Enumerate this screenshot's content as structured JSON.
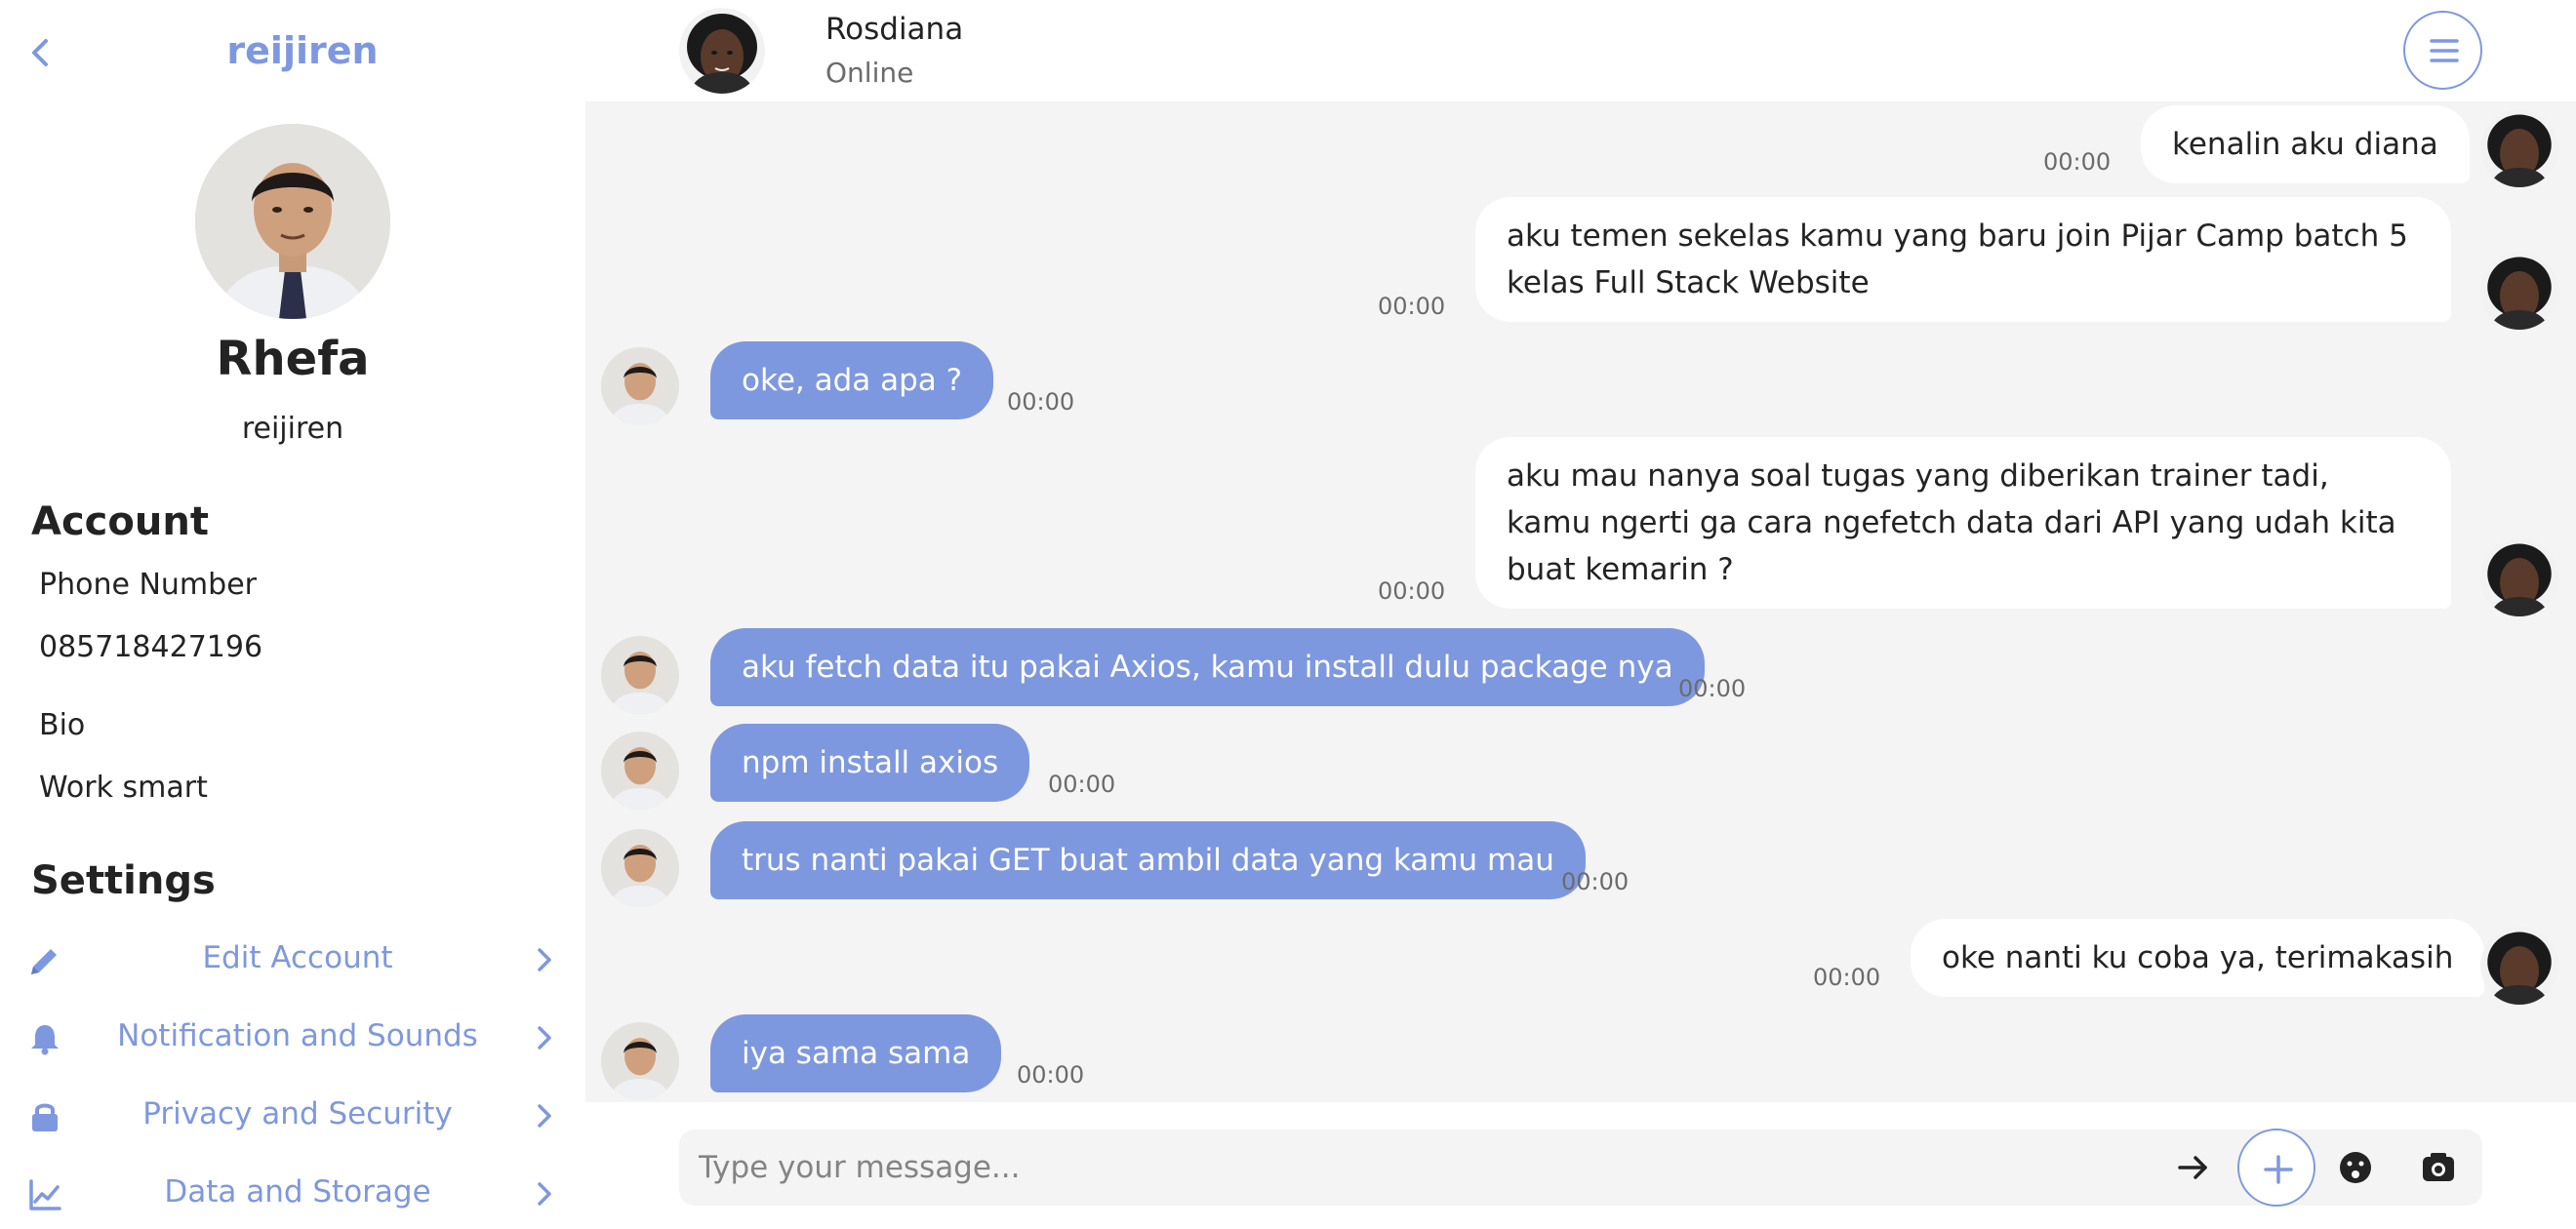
{
  "sidebar": {
    "header_username": "reijiren",
    "profile": {
      "name": "Rhefa",
      "username": "reijiren"
    },
    "account": {
      "title": "Account",
      "phone_label": "Phone Number",
      "phone_value": "085718427196",
      "bio_label": "Bio",
      "bio_value": "Work smart"
    },
    "settings": {
      "title": "Settings",
      "items": [
        {
          "label": "Edit Account",
          "icon": "pencil-icon"
        },
        {
          "label": "Notification and Sounds",
          "icon": "bell-icon"
        },
        {
          "label": "Privacy and Security",
          "icon": "lock-icon"
        },
        {
          "label": "Data and Storage",
          "icon": "chart-line-icon"
        }
      ]
    }
  },
  "chat": {
    "contact": {
      "name": "Rosdiana",
      "status": "Online"
    },
    "messages": [
      {
        "from": "contact",
        "text": "kenalin aku diana",
        "time": "00:00"
      },
      {
        "from": "contact",
        "text": "aku temen sekelas kamu yang baru join Pijar Camp batch 5 kelas Full Stack Website",
        "time": "00:00"
      },
      {
        "from": "me",
        "text": "oke, ada apa ?",
        "time": "00:00"
      },
      {
        "from": "contact",
        "text": "aku mau nanya soal tugas yang diberikan trainer tadi, kamu ngerti ga cara ngefetch data dari API yang udah kita buat kemarin ?",
        "time": "00:00"
      },
      {
        "from": "me",
        "text": "aku fetch data itu pakai Axios, kamu install dulu package nya",
        "time": "00:00"
      },
      {
        "from": "me",
        "text": "npm install axios",
        "time": "00:00"
      },
      {
        "from": "me",
        "text": "trus nanti pakai GET buat ambil data yang kamu mau",
        "time": "00:00"
      },
      {
        "from": "contact",
        "text": "oke nanti ku coba ya, terimakasih",
        "time": "00:00"
      },
      {
        "from": "me",
        "text": "iya sama sama",
        "time": "00:00"
      }
    ],
    "input": {
      "placeholder": "Type your message...",
      "value": ""
    }
  },
  "colors": {
    "accent": "#7e98df",
    "chat_background": "#f4f4f4",
    "text": "#232323"
  }
}
